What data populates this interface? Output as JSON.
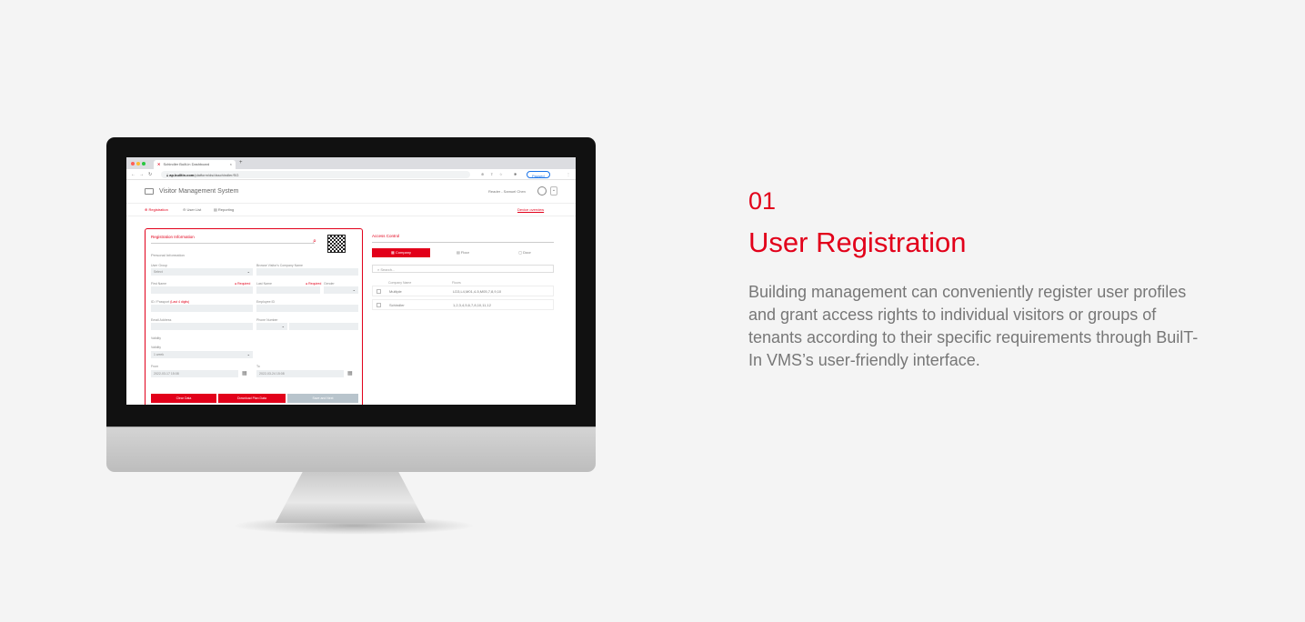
{
  "accent_color": "#e2001a",
  "feature": {
    "number": "01",
    "title": "User Registration",
    "description": "Building management can conveniently register user profiles and grant access rights to individual visitors or groups of tenants according to their specific requirements through BuilT-In VMS’s user-friendly interface."
  },
  "browser": {
    "tab_title": "Schindler Built-in Dashboard",
    "url_domain": "ap.builtin.com",
    "url_path": "/platform/ds/dsschindler/SG",
    "paused_label": "Paused"
  },
  "app": {
    "title": "Visitor Management System",
    "user": "Reader - Samuel Chen",
    "menu": [
      "Registration",
      "User List",
      "Reporting"
    ],
    "menu_right": "Device overview"
  },
  "registration": {
    "title": "Registration Information",
    "subtitle": "Personal Information",
    "labels": {
      "user_group": "User Group",
      "company": "Browse Visitor's Company Name",
      "first_name": "First Name",
      "last_name": "Last Name",
      "gender": "Gender",
      "required": "Required",
      "passport": "ID / Passport",
      "passport_hint": "(Last 4 digits)",
      "employee_id": "Employee ID",
      "email": "Email Address",
      "phone": "Phone Number",
      "validity": "Validity",
      "validity2": "Validity",
      "from": "From",
      "to": "To"
    },
    "values": {
      "user_group": "Select",
      "validity": "1 week",
      "from": "2022-03-17 15:08",
      "to": "2022-03-24 15:08"
    },
    "buttons": [
      "Clear Data",
      "Download Plan Data",
      "Save and Next"
    ]
  },
  "access": {
    "title": "Access Control",
    "tabs": [
      "Company",
      "Floor",
      "Door"
    ],
    "search_placeholder": "Search...",
    "columns": [
      "Company Name",
      "Floors"
    ],
    "rows": [
      {
        "company": "Multiple",
        "floors": "LD3,L4,M01,4-5,M05,7,8,9,10"
      },
      {
        "company": "Schindler",
        "floors": "1,2,3,4,5,6,7,8,10,11,12"
      }
    ]
  }
}
